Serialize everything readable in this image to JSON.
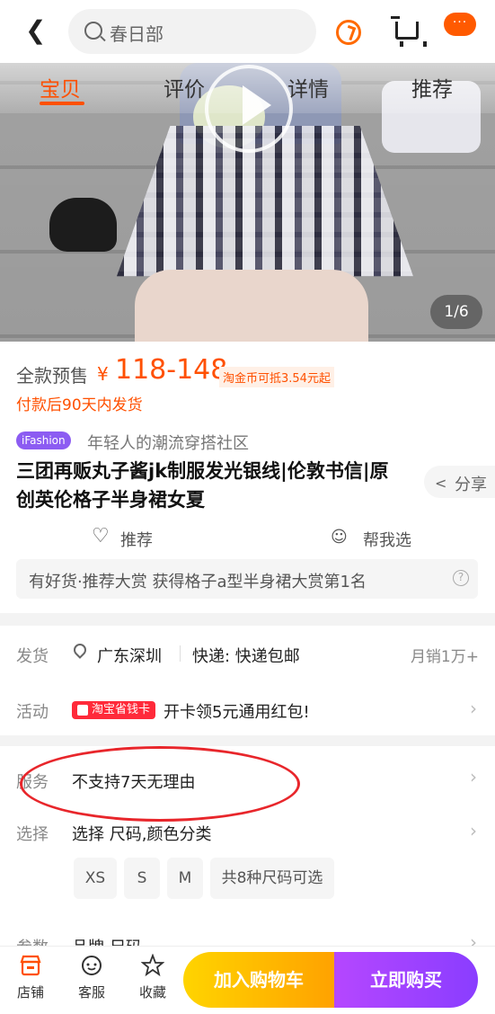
{
  "topbar": {
    "search_text": "春日部",
    "more_label": "···"
  },
  "tabs": [
    "宝贝",
    "评价",
    "详情",
    "推荐"
  ],
  "gallery": {
    "counter": "1/6"
  },
  "price": {
    "presale_label": "全款预售",
    "currency": "¥",
    "range": "118-148",
    "coin_note": "淘金币可抵3.54元起",
    "ship_note": "付款后90天内发货"
  },
  "tag": {
    "name": "iFashion",
    "desc": "年轻人的潮流穿搭社区"
  },
  "title_line1": "三团再贩丸子酱jk制服发光银线|伦敦书信|原",
  "title_line2": "创英伦格子半身裙女夏",
  "share_label": "分享",
  "recommend_label": "推荐",
  "help_choose_label": "帮我选",
  "award_text": "有好货·推荐大赏 获得格子a型半身裙大赏第1名",
  "delivery": {
    "label": "发货",
    "location": "广东深圳",
    "express": "快递: 快递包邮",
    "sales": "月销1万+"
  },
  "activity": {
    "label": "活动",
    "badge": "淘宝省钱卡",
    "text": "开卡领5元通用红包!"
  },
  "service": {
    "label": "服务",
    "text": "不支持7天无理由"
  },
  "select": {
    "label": "选择",
    "text": "选择 尺码,颜色分类",
    "sizes": [
      "XS",
      "S",
      "M",
      "共8种尺码可选"
    ]
  },
  "params": {
    "label": "参数",
    "text": "品牌 尺码"
  },
  "bottom": {
    "shop": "店铺",
    "service": "客服",
    "favorite": "收藏",
    "add_cart": "加入购物车",
    "buy_now": "立即购买"
  },
  "colors": {
    "accent": "#ff5000",
    "cart_btn": "#ffa200",
    "buy_btn": "#8a3dff"
  }
}
